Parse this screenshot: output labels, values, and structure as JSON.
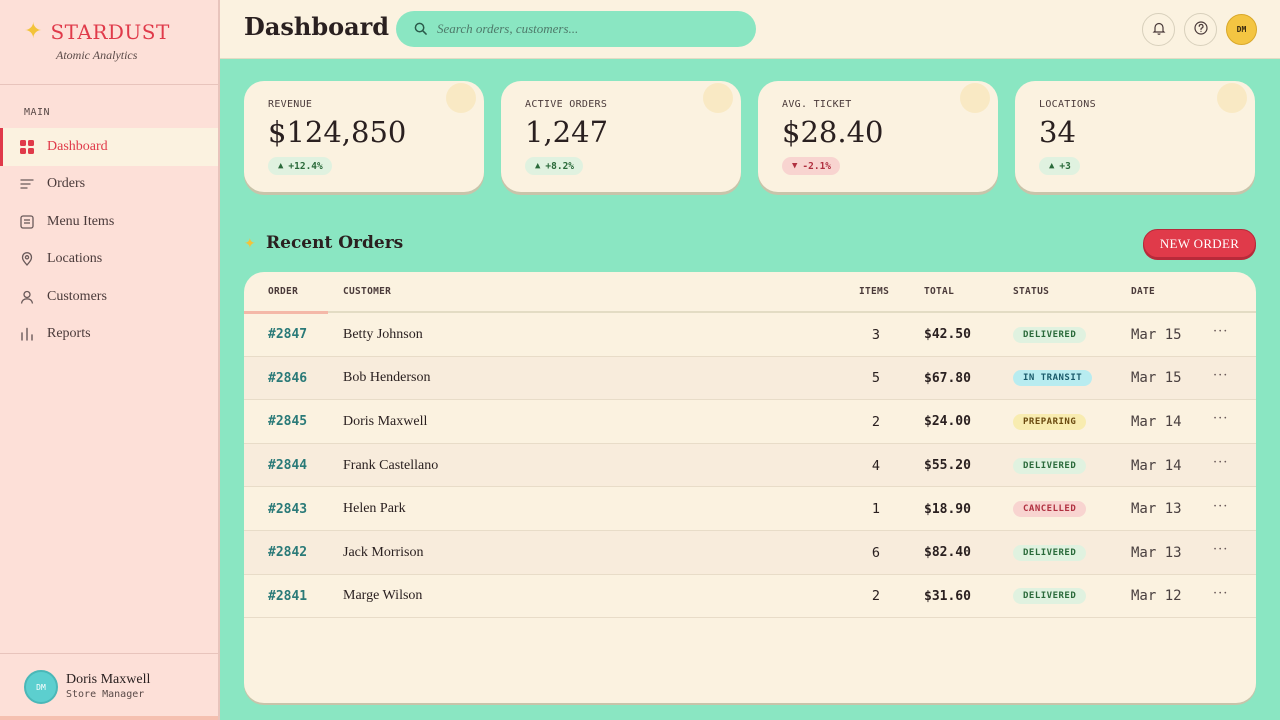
{
  "brand": {
    "name": "STARDUST",
    "tagline": "Atomic Analytics"
  },
  "sidebar": {
    "section_label": "MAIN",
    "items": [
      {
        "label": "Dashboard",
        "icon": "grid-icon",
        "active": true
      },
      {
        "label": "Orders",
        "icon": "list-icon"
      },
      {
        "label": "Menu Items",
        "icon": "menu-icon"
      },
      {
        "label": "Locations",
        "icon": "pin-icon"
      },
      {
        "label": "Customers",
        "icon": "user-icon"
      },
      {
        "label": "Reports",
        "icon": "bar-chart-icon"
      }
    ],
    "user": {
      "initials": "DM",
      "name": "Doris Maxwell",
      "role": "Store Manager"
    }
  },
  "header": {
    "title": "Dashboard",
    "search_placeholder": "Search orders, customers...",
    "avatar_initials": "DM"
  },
  "stats": [
    {
      "label": "REVENUE",
      "value": "$124,850",
      "delta": "+12.4%",
      "direction": "up"
    },
    {
      "label": "ACTIVE ORDERS",
      "value": "1,247",
      "delta": "+8.2%",
      "direction": "up"
    },
    {
      "label": "AVG. TICKET",
      "value": "$28.40",
      "delta": "-2.1%",
      "direction": "down"
    },
    {
      "label": "LOCATIONS",
      "value": "34",
      "delta": "+3",
      "direction": "up"
    }
  ],
  "recent_orders": {
    "title": "Recent Orders",
    "new_order_label": "NEW ORDER",
    "columns": [
      "ORDER",
      "CUSTOMER",
      "ITEMS",
      "TOTAL",
      "STATUS",
      "DATE"
    ],
    "rows": [
      {
        "order": "#2847",
        "customer": "Betty Johnson",
        "items": "3",
        "total": "$42.50",
        "status": "DELIVERED",
        "date": "Mar 15"
      },
      {
        "order": "#2846",
        "customer": "Bob Henderson",
        "items": "5",
        "total": "$67.80",
        "status": "IN TRANSIT",
        "date": "Mar 15"
      },
      {
        "order": "#2845",
        "customer": "Doris Maxwell",
        "items": "2",
        "total": "$24.00",
        "status": "PREPARING",
        "date": "Mar 14"
      },
      {
        "order": "#2844",
        "customer": "Frank Castellano",
        "items": "4",
        "total": "$55.20",
        "status": "DELIVERED",
        "date": "Mar 14"
      },
      {
        "order": "#2843",
        "customer": "Helen Park",
        "items": "1",
        "total": "$18.90",
        "status": "CANCELLED",
        "date": "Mar 13"
      },
      {
        "order": "#2842",
        "customer": "Jack Morrison",
        "items": "6",
        "total": "$82.40",
        "status": "DELIVERED",
        "date": "Mar 13"
      },
      {
        "order": "#2841",
        "customer": "Marge Wilson",
        "items": "2",
        "total": "$31.60",
        "status": "DELIVERED",
        "date": "Mar 12"
      }
    ],
    "row_action": "···"
  },
  "colors": {
    "brand_red": "#e03a4a",
    "mint_bg": "#8ae6c2",
    "cream": "#fbf2e0",
    "teal_link": "#2a7a78",
    "delivered_bg": "#e0f2e0",
    "delivered_fg": "#2a6a3a",
    "transit_bg": "#b8ecf0",
    "transit_fg": "#1a5a6a",
    "preparing_bg": "#f8ecb0",
    "preparing_fg": "#6a4a10",
    "cancelled_bg": "#f8d4d0",
    "cancelled_fg": "#b03040"
  }
}
